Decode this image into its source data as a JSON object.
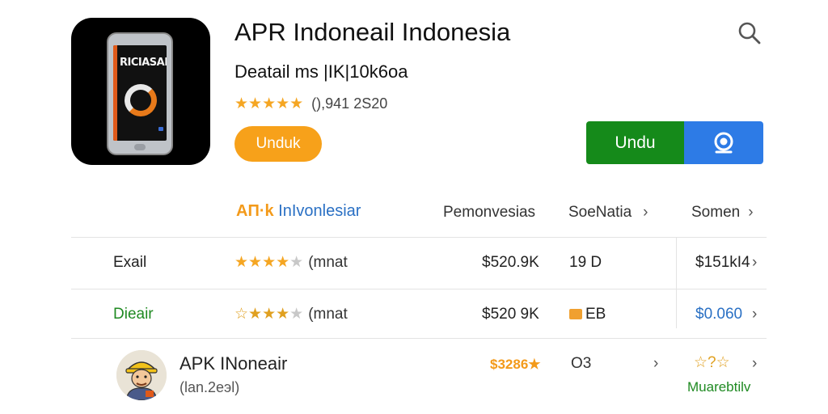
{
  "header": {
    "title": "APR Indoneail Indonesia",
    "subtitle": "Deatail ms |IK|10k6oa",
    "stars": "★★★★★",
    "rating_count": "(),941 2S20",
    "install_label": "Unduk",
    "download_label": "Undu",
    "phone_screen_text": "RICIASAI"
  },
  "icons": {
    "search": "search-icon",
    "share": "support-icon",
    "colors": {
      "orange": "#f7a11a",
      "green": "#158a1a",
      "blue": "#2d7be6"
    }
  },
  "table": {
    "header": {
      "brand_a": "AП·k",
      "brand_b": "InIvonlesiar",
      "col_price": "Pemonvesias",
      "col_size": "SoeNatia",
      "col_last": "Somen"
    },
    "rows": [
      {
        "name": "Exail",
        "stars": "★★★★",
        "stars_off": "★",
        "rating_text": "(mnat",
        "price": "$520.9K",
        "size": "19 D",
        "last": "$151kI4"
      },
      {
        "name": "Dieair",
        "stars": "☆★★★",
        "stars_off": "★",
        "rating_text": "(mnat",
        "price": "$520 9K",
        "size": "EB",
        "last": "$0.060"
      }
    ],
    "featured": {
      "title": "APK INoneair",
      "subtitle": "(lan.2eэl)",
      "price": "$3286★",
      "size": "O3",
      "stars": "☆?☆",
      "status": "Muarebtilv",
      "chevron": "›"
    }
  },
  "chevron": "›"
}
